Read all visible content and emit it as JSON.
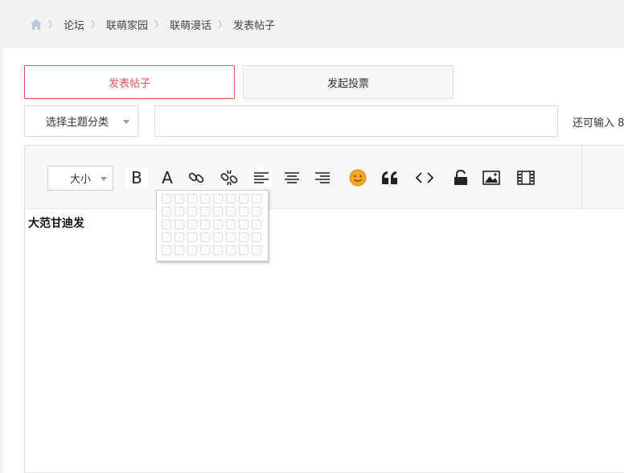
{
  "breadcrumb": {
    "items": [
      "论坛",
      "联萌家园",
      "联萌漫话",
      "发表帖子"
    ]
  },
  "tabs": [
    {
      "label": "发表帖子",
      "active": true
    },
    {
      "label": "发起投票",
      "active": false
    }
  ],
  "category_select": {
    "label": "选择主题分类"
  },
  "subject_input": {
    "value": ""
  },
  "counter": {
    "text": "还可输入 8"
  },
  "toolbar": {
    "size_label": "大小",
    "icons": [
      "bold-icon",
      "font-color-icon",
      "link-icon",
      "unlink-icon",
      "align-left-icon",
      "align-center-icon",
      "align-right-icon",
      "emoji-icon",
      "quote-icon",
      "code-icon",
      "lock-icon",
      "image-icon",
      "video-icon"
    ]
  },
  "editor": {
    "content": "大范甘迪发"
  },
  "table_picker": {
    "rows": 5,
    "cols": 8
  },
  "colors": {
    "accent": "#e05a5a",
    "emoji": "#f5a623"
  }
}
